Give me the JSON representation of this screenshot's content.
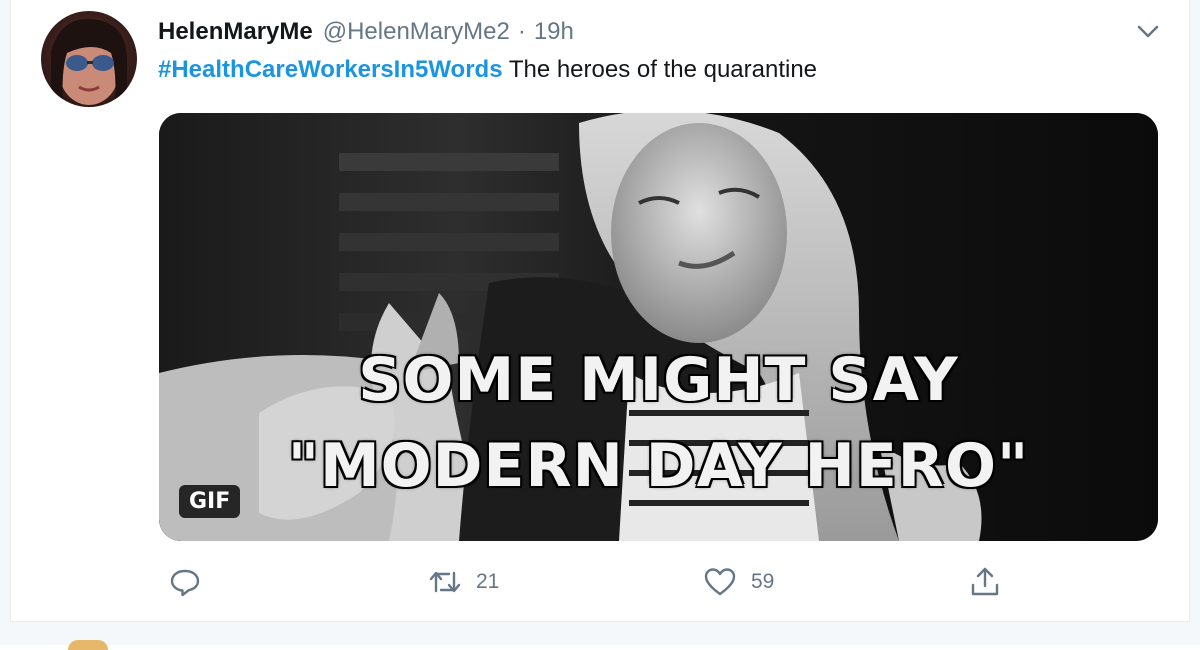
{
  "tweet": {
    "display_name": "HelenMaryMe",
    "handle": "@HelenMaryMe2",
    "separator": "·",
    "time": "19h",
    "hashtag": "#HealthCareWorkersIn5Words",
    "text": " The heroes of the quarantine",
    "media": {
      "caption_line1": "SOME MIGHT SAY",
      "caption_line2": "\"MODERN DAY HERO\"",
      "badge": "GIF"
    },
    "actions": {
      "reply_count": "",
      "retweet_count": "21",
      "like_count": "59"
    }
  },
  "icons": {
    "menu": "chevron-down-icon",
    "reply": "reply-icon",
    "retweet": "retweet-icon",
    "like": "heart-icon",
    "share": "share-icon"
  },
  "colors": {
    "link": "#1b95e0",
    "text": "#14171a",
    "secondary": "#657786"
  }
}
